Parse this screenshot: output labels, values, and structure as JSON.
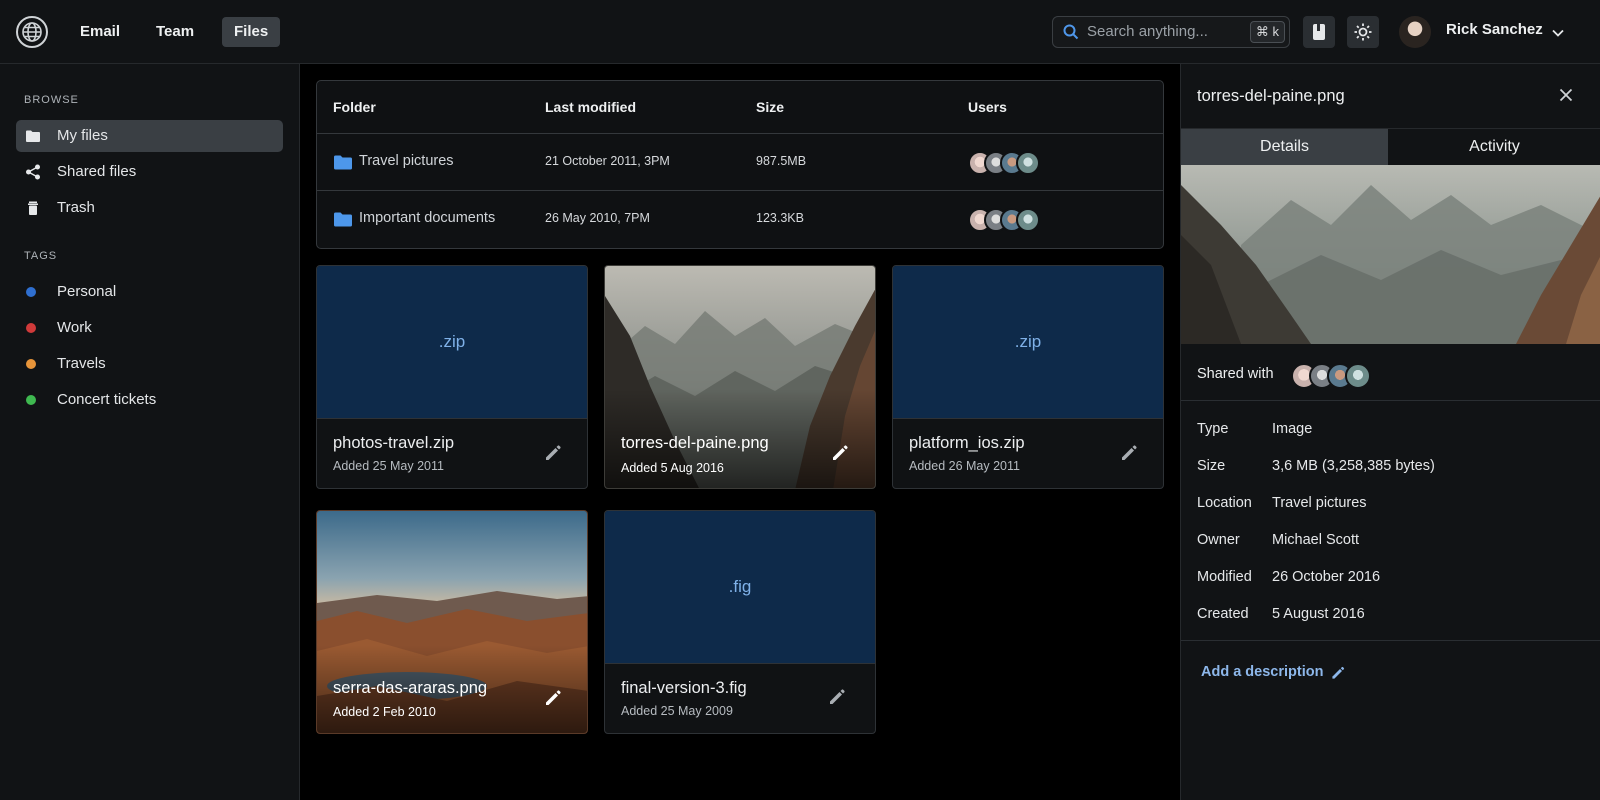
{
  "header": {
    "nav": [
      "Email",
      "Team",
      "Files"
    ],
    "active_nav": "Files",
    "search_placeholder": "Search anything...",
    "search_shortcut": "⌘ k",
    "user_name": "Rick Sanchez"
  },
  "sidebar": {
    "browse_label": "BROWSE",
    "browse_items": [
      {
        "label": "My files",
        "icon": "folder-icon",
        "active": true
      },
      {
        "label": "Shared files",
        "icon": "share-icon",
        "active": false
      },
      {
        "label": "Trash",
        "icon": "trash-icon",
        "active": false
      }
    ],
    "tags_label": "TAGS",
    "tags": [
      {
        "label": "Personal",
        "color": "#2f6fd0"
      },
      {
        "label": "Work",
        "color": "#d03a3a"
      },
      {
        "label": "Travels",
        "color": "#e8953a"
      },
      {
        "label": "Concert tickets",
        "color": "#3fb950"
      }
    ]
  },
  "folders": {
    "columns": [
      "Folder",
      "Last modified",
      "Size",
      "Users"
    ],
    "rows": [
      {
        "name": "Travel pictures",
        "modified": "21 October 2011, 3PM",
        "size": "987.5MB"
      },
      {
        "name": "Important documents",
        "modified": "26 May 2010, 7PM",
        "size": "123.3KB"
      }
    ]
  },
  "files": [
    {
      "name": "photos-travel.zip",
      "added": "Added 25 May 2011",
      "ext": ".zip",
      "kind": "ext"
    },
    {
      "name": "torres-del-paine.png",
      "added": "Added 5 Aug 2016",
      "ext": "",
      "kind": "photo"
    },
    {
      "name": "platform_ios.zip",
      "added": "Added 26 May 2011",
      "ext": ".zip",
      "kind": "ext"
    },
    {
      "name": "serra-das-araras.png",
      "added": "Added 2 Feb 2010",
      "ext": "",
      "kind": "photo"
    },
    {
      "name": "final-version-3.fig",
      "added": "Added 25 May 2009",
      "ext": ".fig",
      "kind": "ext"
    }
  ],
  "details": {
    "title": "torres-del-paine.png",
    "tabs": [
      "Details",
      "Activity"
    ],
    "active_tab": "Details",
    "shared_with_label": "Shared with",
    "meta": [
      {
        "key": "Type",
        "value": "Image"
      },
      {
        "key": "Size",
        "value": "3,6 MB (3,258,385 bytes)"
      },
      {
        "key": "Location",
        "value": "Travel pictures"
      },
      {
        "key": "Owner",
        "value": "Michael Scott"
      },
      {
        "key": "Modified",
        "value": "26 October 2016"
      },
      {
        "key": "Created",
        "value": "5 August 2016"
      }
    ],
    "add_description": "Add a description"
  },
  "colors": {
    "accent": "#8db7ea",
    "file_tile": "#0e2a4a",
    "active_bg": "#3a3f44"
  }
}
